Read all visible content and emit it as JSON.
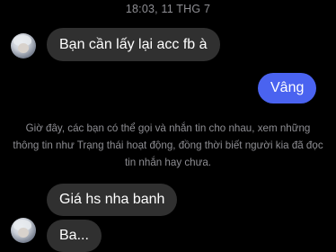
{
  "chat": {
    "timestamp": "18:03, 11 THG 7",
    "messages": [
      {
        "from": "other",
        "text": "Bạn cần lấy lại acc fb à"
      },
      {
        "from": "me",
        "text": "Vâng"
      },
      {
        "from": "other",
        "text": "Giá hs nha banh"
      },
      {
        "from": "other",
        "text": "Ba..."
      }
    ],
    "system_notice": "Giờ đây, các bạn có thể gọi và nhắn tin cho nhau, xem những thông tin như Trạng thái hoạt động, đồng thời biết người kia đã đọc tin nhắn hay chưa."
  },
  "colors": {
    "background": "#000000",
    "received_bubble": "#303030",
    "sent_bubble": "#4a63f0",
    "muted_text": "#8e8e93"
  }
}
